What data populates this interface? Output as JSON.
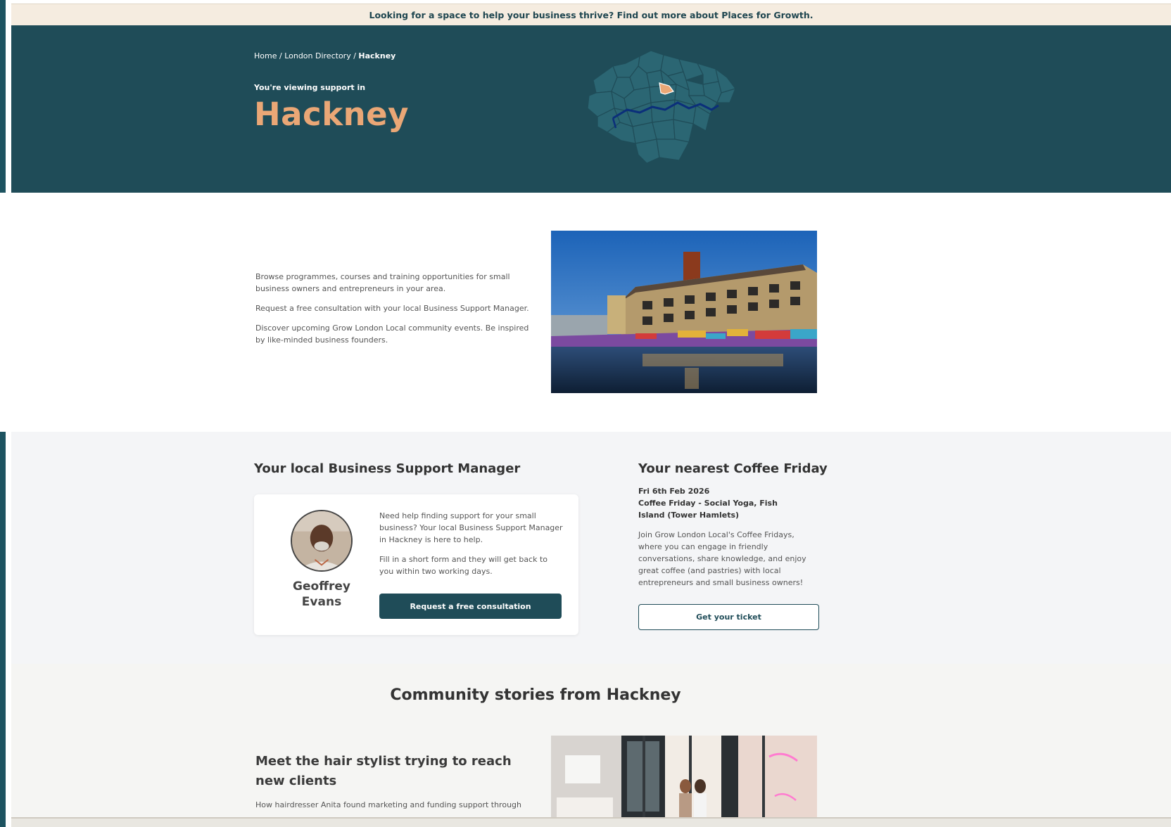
{
  "announcement": {
    "text": "Looking for a space to help your business thrive? Find out more about Places for Growth."
  },
  "breadcrumb": {
    "home": "Home",
    "directory": "London Directory",
    "current": "Hackney",
    "sep": " / "
  },
  "hero": {
    "viewing_label": "You're viewing support in",
    "borough": "Hackney"
  },
  "intro": {
    "paragraphs": [
      "Browse programmes, courses and training opportunities for small business owners and entrepreneurs in your area.",
      "Request a free consultation with your local Business Support Manager.",
      "Discover upcoming Grow London Local community events. Be inspired by like-minded business founders."
    ]
  },
  "manager": {
    "heading": "Your local Business Support Manager",
    "first_name": "Geoffrey",
    "last_name": "Evans",
    "text1": "Need help finding support for your small business? Your local Business Support Manager in Hackney is here to help.",
    "text2": "Fill in a short form and they will get back to you within two working days.",
    "cta": "Request a free consultation"
  },
  "coffee_friday": {
    "heading": "Your nearest Coffee Friday",
    "date": "Fri 6th Feb 2026",
    "event": "Coffee Friday - Social Yoga, Fish Island (Tower Hamlets)",
    "description": "Join Grow London Local's Coffee Fridays, where you can engage in friendly conversations, share knowledge, and enjoy great coffee (and pastries) with local entrepreneurs and small business owners!",
    "cta": "Get your ticket"
  },
  "community": {
    "heading": "Community stories from Hackney",
    "story_title": "Meet the hair stylist trying to reach new clients",
    "story_excerpt": "How hairdresser Anita found marketing and funding support through"
  },
  "colors": {
    "brand_teal": "#1f4c58",
    "accent_orange": "#eaa776",
    "announce_bg": "#f5ece0",
    "map_fill": "#2b6673"
  },
  "icons": {
    "map": "london-boroughs-map",
    "marker": "location-marker-icon"
  }
}
